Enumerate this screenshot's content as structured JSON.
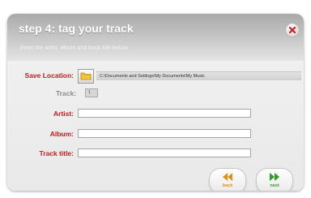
{
  "header": {
    "title": "step 4: tag your track",
    "subtitle": "Enter the artist, album and track title below."
  },
  "form": {
    "save_location": {
      "label": "Save Location:",
      "path": "C:\\Documents and Settings\\My Documents\\My Music"
    },
    "track": {
      "label": "Track:",
      "value": "1"
    },
    "artist": {
      "label": "Artist:",
      "value": ""
    },
    "album": {
      "label": "Album:",
      "value": ""
    },
    "track_title": {
      "label": "Track title:",
      "value": ""
    }
  },
  "nav": {
    "back_label": "back",
    "next_label": "next"
  },
  "colors": {
    "label_red": "#cc1a1a",
    "back_orange": "#e0901a",
    "next_green": "#2f9e25",
    "close_red": "#cc2222"
  },
  "icons": {
    "close": "close-icon",
    "folder": "folder-icon",
    "back": "rewind-icon",
    "next": "fast-forward-icon"
  }
}
